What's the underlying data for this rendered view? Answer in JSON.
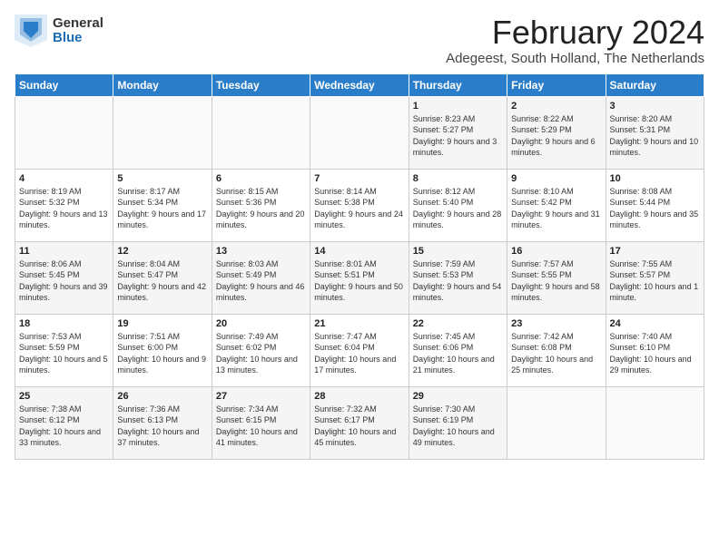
{
  "header": {
    "logo_general": "General",
    "logo_blue": "Blue",
    "title": "February 2024",
    "subtitle": "Adegeest, South Holland, The Netherlands"
  },
  "weekdays": [
    "Sunday",
    "Monday",
    "Tuesday",
    "Wednesday",
    "Thursday",
    "Friday",
    "Saturday"
  ],
  "weeks": [
    [
      {
        "day": "",
        "info": ""
      },
      {
        "day": "",
        "info": ""
      },
      {
        "day": "",
        "info": ""
      },
      {
        "day": "",
        "info": ""
      },
      {
        "day": "1",
        "info": "Sunrise: 8:23 AM\nSunset: 5:27 PM\nDaylight: 9 hours\nand 3 minutes."
      },
      {
        "day": "2",
        "info": "Sunrise: 8:22 AM\nSunset: 5:29 PM\nDaylight: 9 hours\nand 6 minutes."
      },
      {
        "day": "3",
        "info": "Sunrise: 8:20 AM\nSunset: 5:31 PM\nDaylight: 9 hours\nand 10 minutes."
      }
    ],
    [
      {
        "day": "4",
        "info": "Sunrise: 8:19 AM\nSunset: 5:32 PM\nDaylight: 9 hours\nand 13 minutes."
      },
      {
        "day": "5",
        "info": "Sunrise: 8:17 AM\nSunset: 5:34 PM\nDaylight: 9 hours\nand 17 minutes."
      },
      {
        "day": "6",
        "info": "Sunrise: 8:15 AM\nSunset: 5:36 PM\nDaylight: 9 hours\nand 20 minutes."
      },
      {
        "day": "7",
        "info": "Sunrise: 8:14 AM\nSunset: 5:38 PM\nDaylight: 9 hours\nand 24 minutes."
      },
      {
        "day": "8",
        "info": "Sunrise: 8:12 AM\nSunset: 5:40 PM\nDaylight: 9 hours\nand 28 minutes."
      },
      {
        "day": "9",
        "info": "Sunrise: 8:10 AM\nSunset: 5:42 PM\nDaylight: 9 hours\nand 31 minutes."
      },
      {
        "day": "10",
        "info": "Sunrise: 8:08 AM\nSunset: 5:44 PM\nDaylight: 9 hours\nand 35 minutes."
      }
    ],
    [
      {
        "day": "11",
        "info": "Sunrise: 8:06 AM\nSunset: 5:45 PM\nDaylight: 9 hours\nand 39 minutes."
      },
      {
        "day": "12",
        "info": "Sunrise: 8:04 AM\nSunset: 5:47 PM\nDaylight: 9 hours\nand 42 minutes."
      },
      {
        "day": "13",
        "info": "Sunrise: 8:03 AM\nSunset: 5:49 PM\nDaylight: 9 hours\nand 46 minutes."
      },
      {
        "day": "14",
        "info": "Sunrise: 8:01 AM\nSunset: 5:51 PM\nDaylight: 9 hours\nand 50 minutes."
      },
      {
        "day": "15",
        "info": "Sunrise: 7:59 AM\nSunset: 5:53 PM\nDaylight: 9 hours\nand 54 minutes."
      },
      {
        "day": "16",
        "info": "Sunrise: 7:57 AM\nSunset: 5:55 PM\nDaylight: 9 hours\nand 58 minutes."
      },
      {
        "day": "17",
        "info": "Sunrise: 7:55 AM\nSunset: 5:57 PM\nDaylight: 10 hours\nand 1 minute."
      }
    ],
    [
      {
        "day": "18",
        "info": "Sunrise: 7:53 AM\nSunset: 5:59 PM\nDaylight: 10 hours\nand 5 minutes."
      },
      {
        "day": "19",
        "info": "Sunrise: 7:51 AM\nSunset: 6:00 PM\nDaylight: 10 hours\nand 9 minutes."
      },
      {
        "day": "20",
        "info": "Sunrise: 7:49 AM\nSunset: 6:02 PM\nDaylight: 10 hours\nand 13 minutes."
      },
      {
        "day": "21",
        "info": "Sunrise: 7:47 AM\nSunset: 6:04 PM\nDaylight: 10 hours\nand 17 minutes."
      },
      {
        "day": "22",
        "info": "Sunrise: 7:45 AM\nSunset: 6:06 PM\nDaylight: 10 hours\nand 21 minutes."
      },
      {
        "day": "23",
        "info": "Sunrise: 7:42 AM\nSunset: 6:08 PM\nDaylight: 10 hours\nand 25 minutes."
      },
      {
        "day": "24",
        "info": "Sunrise: 7:40 AM\nSunset: 6:10 PM\nDaylight: 10 hours\nand 29 minutes."
      }
    ],
    [
      {
        "day": "25",
        "info": "Sunrise: 7:38 AM\nSunset: 6:12 PM\nDaylight: 10 hours\nand 33 minutes."
      },
      {
        "day": "26",
        "info": "Sunrise: 7:36 AM\nSunset: 6:13 PM\nDaylight: 10 hours\nand 37 minutes."
      },
      {
        "day": "27",
        "info": "Sunrise: 7:34 AM\nSunset: 6:15 PM\nDaylight: 10 hours\nand 41 minutes."
      },
      {
        "day": "28",
        "info": "Sunrise: 7:32 AM\nSunset: 6:17 PM\nDaylight: 10 hours\nand 45 minutes."
      },
      {
        "day": "29",
        "info": "Sunrise: 7:30 AM\nSunset: 6:19 PM\nDaylight: 10 hours\nand 49 minutes."
      },
      {
        "day": "",
        "info": ""
      },
      {
        "day": "",
        "info": ""
      }
    ]
  ]
}
